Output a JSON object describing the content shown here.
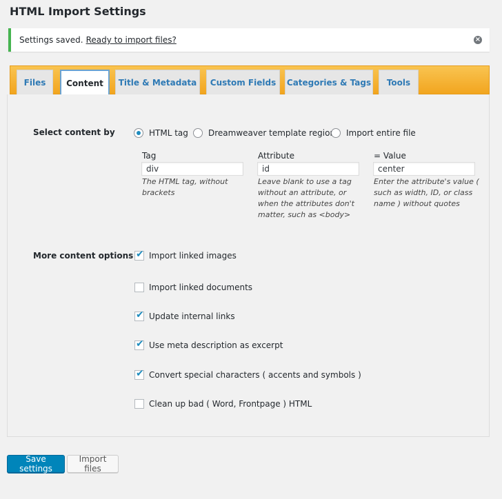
{
  "page": {
    "title": "HTML Import Settings"
  },
  "notice": {
    "text": "Settings saved.",
    "link": "Ready to import files?",
    "dismiss_icon": "close-icon"
  },
  "tabs": [
    {
      "label": "Files"
    },
    {
      "label": "Content",
      "active": true
    },
    {
      "label": "Title & Metadata"
    },
    {
      "label": "Custom Fields"
    },
    {
      "label": "Categories & Tags"
    },
    {
      "label": "Tools"
    }
  ],
  "content": {
    "select_label": "Select content by",
    "options": [
      {
        "label": "HTML tag",
        "checked": true
      },
      {
        "label": "Dreamweaver template region",
        "checked": false
      },
      {
        "label": "Import entire file",
        "checked": false
      }
    ],
    "fields": {
      "tag": {
        "label": "Tag",
        "value": "div",
        "desc_lines": [
          "The HTML tag, without",
          "brackets"
        ]
      },
      "attribute": {
        "label": "Attribute",
        "value": "id",
        "desc_lines": [
          "Leave blank to use a tag",
          "without an attribute, or",
          "when the attributes don't",
          "matter, such as <body>"
        ]
      },
      "value": {
        "label": "= Value",
        "value": "center",
        "desc_lines": [
          "Enter the attribute's value (",
          "such as width, ID, or class",
          "name ) without quotes"
        ]
      }
    },
    "more_label": "More content options",
    "checkboxes": [
      {
        "label": "Import linked images",
        "checked": true
      },
      {
        "label": "Import linked documents",
        "checked": false
      },
      {
        "label": "Update internal links",
        "checked": true
      },
      {
        "label": "Use meta description as excerpt",
        "checked": true
      },
      {
        "label": "Convert special characters ( accents and symbols )",
        "checked": true
      },
      {
        "label": "Clean up bad ( Word, Frontpage ) HTML",
        "checked": false
      }
    ],
    "check_glyph": "✔"
  },
  "buttons": {
    "save": "Save settings",
    "import": "Import files"
  }
}
